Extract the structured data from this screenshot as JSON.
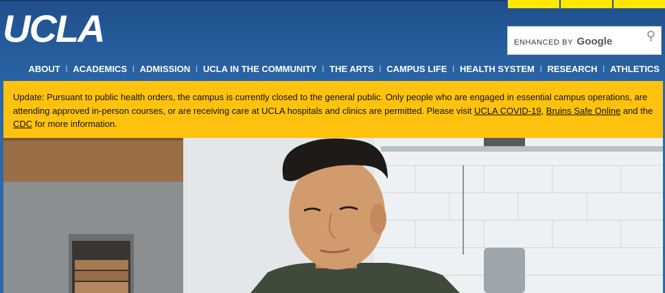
{
  "logo": {
    "text": "UCLA"
  },
  "search": {
    "powered_by": "ENHANCED BY",
    "brand": "Google"
  },
  "nav": {
    "items": [
      {
        "label": "ABOUT"
      },
      {
        "label": "ACADEMICS"
      },
      {
        "label": "ADMISSION"
      },
      {
        "label": "UCLA IN THE COMMUNITY"
      },
      {
        "label": "THE ARTS"
      },
      {
        "label": "CAMPUS LIFE"
      },
      {
        "label": "HEALTH SYSTEM"
      },
      {
        "label": "RESEARCH"
      },
      {
        "label": "ATHLETICS"
      }
    ]
  },
  "alert": {
    "text_before": "Update: Pursuant to public health orders, the campus is currently closed to the general public. Only people who are engaged in essential campus operations, are attending approved in-person courses, or are receiving care at UCLA hospitals and clinics are permitted. Please visit ",
    "link1": "UCLA COVID-19",
    "sep1": ", ",
    "link2": "Bruins Safe Online",
    "sep2": " and the ",
    "link3": "CDC",
    "text_after": " for more information."
  },
  "colors": {
    "header": "#2a64a6",
    "alert": "#ffc20e",
    "accent": "#ffe800"
  }
}
